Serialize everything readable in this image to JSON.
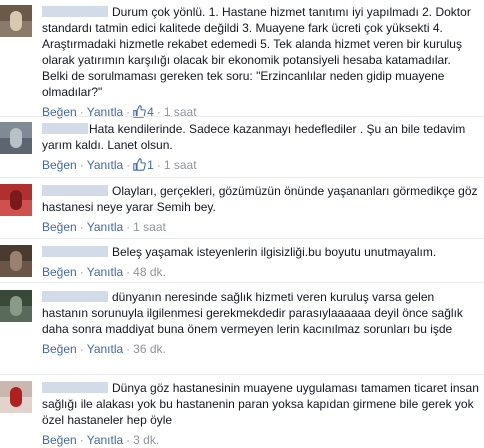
{
  "comments": [
    {
      "text": "Durum çok yönlü. 1. Hastane hizmet tanıtımı iyi yapılmadı 2. Doktor standardı tatmin edici kalitede değildi 3. Muayene fark ücreti çok yüksekti 4. Araştırmadaki hizmetle rekabet edemedi 5. Tek alanda hizmet veren bir kuruluş olarak yatırımın karşılığı olacak bir ekonomik potansiyeli hesaba katamadılar. Belki de sorulmaması gereken tek soru: \"Erzincanlılar neden gidip muayene olmadılar?\"",
      "like_label": "Beğen",
      "reply_label": "Yanıtla",
      "likes": "4",
      "time": "1 saat",
      "colors": [
        "#6b5a4a",
        "#8a7a6a",
        "#d9c8b0"
      ]
    },
    {
      "text": "Hata kendilerinde. Sadece kazanmayı hedeflediler . Şu an bile tedavim yarım kaldı. Lanet olsun.",
      "like_label": "Beğen",
      "reply_label": "Yanıtla",
      "likes": "1",
      "time": "1 saat",
      "colors": [
        "#7f8a94",
        "#5d6570",
        "#b8c0c8"
      ]
    },
    {
      "text": "Olayları, gerçekleri, gözümüzün önünde yaşananları görmedikçe göz hastanesi neye yarar Semih bey.",
      "like_label": "Beğen",
      "reply_label": "Yanıtla",
      "time": "1 saat",
      "colors": [
        "#b03030",
        "#d05050",
        "#7a1a1a"
      ]
    },
    {
      "text": "Beleş yaşamak isteyenlerin ilgisizliği.bu boyutu unutmayalım.",
      "like_label": "Beğen",
      "reply_label": "Yanıtla",
      "time": "48 dk.",
      "colors": [
        "#4a3a30",
        "#6a5546",
        "#9a8070"
      ]
    },
    {
      "text": "dünyanın neresinde sağlık hizmeti veren kuruluş varsa gelen hastanın sorunuyla ilgilenmesi gerekmekdedir parasıylaaaaaa deyil önce sağlık daha sonra maddiyat buna önem vermeyen lerin kacınılmaz sorunları bu işde",
      "like_label": "Beğen",
      "reply_label": "Yanıtla",
      "time": "36 dk.",
      "colors": [
        "#3a4a3a",
        "#5a6a5a",
        "#8a9a88"
      ]
    },
    {
      "text": "Dünya göz hastanesinin muayene uygulaması tamamen ticaret insan sağlığı ile alakası yok bu hastanenin paran yoksa kapıdan girmene bile gerek yok özel hastaneler hep öyle",
      "like_label": "Beğen",
      "reply_label": "Yanıtla",
      "time": "3 dk.",
      "colors": [
        "#c8b8b0",
        "#e0d4cc",
        "#b02020"
      ]
    }
  ]
}
